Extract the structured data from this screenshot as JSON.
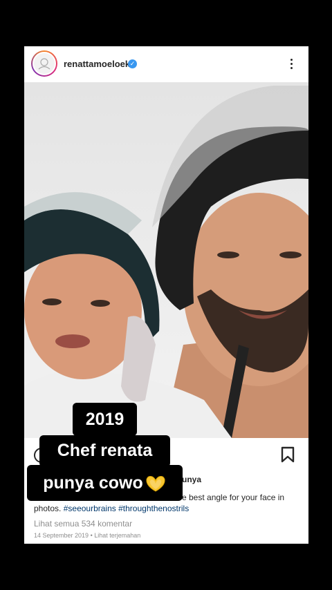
{
  "post": {
    "username": "renattamoeloek",
    "verified_icon": "check",
    "caption_fragment_right": "e best angle for your face in",
    "caption_name_fragment": "unya",
    "caption_continuation": "photos.",
    "hashtags": [
      "#seeourbrains",
      "#throughthenostrils"
    ],
    "view_comments": "Lihat semua 534 komentar",
    "date": "14 September 2019",
    "translate": "Lihat terjemahan",
    "date_separator": "•"
  },
  "overlay": {
    "line1": "2019",
    "line2": "Chef renata",
    "line3": "punya cowo"
  },
  "icons": {
    "more": "more-vertical-icon",
    "bookmark": "bookmark-icon",
    "emoji": "heart-hands-emoji"
  }
}
